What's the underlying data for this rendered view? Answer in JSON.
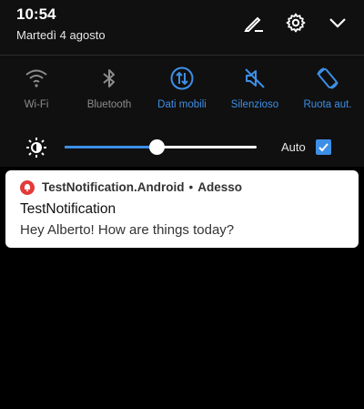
{
  "status": {
    "time": "10:54",
    "date": "Martedì 4 agosto"
  },
  "top_actions": [
    "edit-icon",
    "gear-icon",
    "chevron-down-icon"
  ],
  "tiles": [
    {
      "label": "Wi-Fi",
      "icon": "wifi-icon",
      "active": false
    },
    {
      "label": "Bluetooth",
      "icon": "bluetooth-icon",
      "active": false
    },
    {
      "label": "Dati mobili",
      "icon": "mobile-data-icon",
      "active": true
    },
    {
      "label": "Silenzioso",
      "icon": "silent-icon",
      "active": true
    },
    {
      "label": "Ruota aut.",
      "icon": "auto-rotate-icon",
      "active": true
    }
  ],
  "brightness": {
    "level": 0.48,
    "auto_label": "Auto",
    "auto_checked": true
  },
  "notification": {
    "app_name": "TestNotification.Android",
    "separator": "•",
    "when": "Adesso",
    "title": "TestNotification",
    "text": "Hey Alberto! How are things today?"
  },
  "colors": {
    "accent": "#3d8fe6",
    "inactive": "#8c8c8c",
    "app_icon": "#e23b3b"
  }
}
